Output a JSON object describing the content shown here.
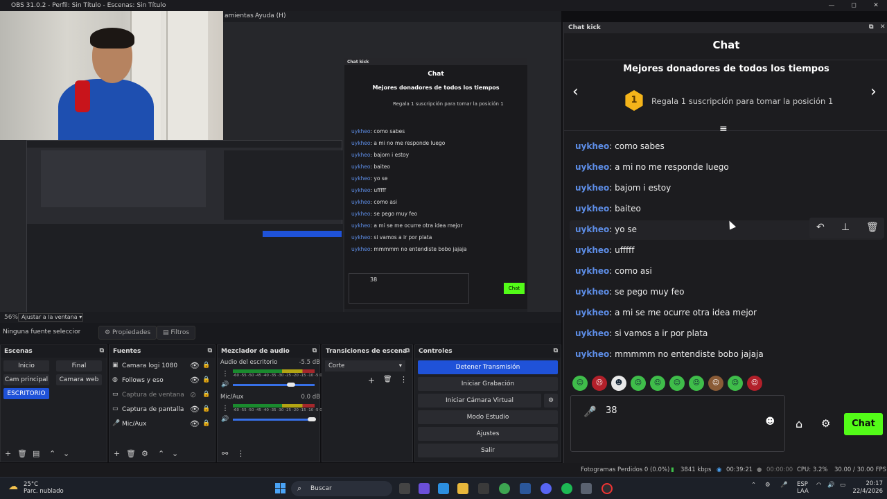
{
  "window": {
    "title": "OBS 31.0.2 - Perfil: Sin Título - Escenas: Sin Título",
    "minimize": "—",
    "maximize": "◻",
    "close": "✕"
  },
  "menu": {
    "item_tools": "amientas",
    "item_help": "Ayuda (H)"
  },
  "preview": {
    "zoom_percent": "56%",
    "zoom_select": "Ajustar a la ventana"
  },
  "properties_bar": {
    "no_source": "Ninguna fuente seleccionada",
    "properties_label": "Propiedades",
    "filters_label": "Filtros"
  },
  "scenes": {
    "title": "Escenas",
    "items": [
      "Inicio",
      "Final",
      "Cam principal",
      "Camara web",
      "ESCRITORIO"
    ],
    "active": "ESCRITORIO"
  },
  "sources": {
    "title": "Fuentes",
    "items": [
      {
        "name": "Camara logi 1080",
        "icon": "camera-icon",
        "visible": true
      },
      {
        "name": "Follows y eso",
        "icon": "globe-icon",
        "visible": true
      },
      {
        "name": "Captura de ventana",
        "icon": "window-icon",
        "visible": false
      },
      {
        "name": "Captura de pantalla",
        "icon": "monitor-icon",
        "visible": true
      },
      {
        "name": "Mic/Aux",
        "icon": "mic-icon",
        "visible": true
      }
    ]
  },
  "mixer": {
    "title": "Mezclador de audio",
    "channels": [
      {
        "name": "Audio del escritorio",
        "db": "-5.5 dB"
      },
      {
        "name": "Mic/Aux",
        "db": "0.0 dB"
      }
    ],
    "ticks": "-60 -55 -50 -45 -40 -35 -30 -25 -20 -15 -10 -5 0"
  },
  "transitions": {
    "title": "Transiciones de escena",
    "selected": "Corte"
  },
  "controls": {
    "title": "Controles",
    "buttons": [
      "Detener Transmisión",
      "Iniciar Grabación",
      "Iniciar Cámara Virtual",
      "Modo Estudio",
      "Ajustes",
      "Salir"
    ]
  },
  "status": {
    "dropped": "Fotogramas Perdidos 0 (0.0%)",
    "kbps": "3841 kbps",
    "stream_time": "00:39:21",
    "rec_time": "00:00:00",
    "cpu": "CPU: 3.2%",
    "fps": "30.00 / 30.00 FPS"
  },
  "chat_dock": {
    "dock_title": "Chat kick",
    "title": "Chat",
    "donors_title": "Mejores donadores de todos los tiempos",
    "medal_rank": "1",
    "gift_text": "Regala 1 suscripción para tomar la posición 1",
    "messages": [
      {
        "user": "uykheo",
        "text": ": como sabes"
      },
      {
        "user": "uykheo",
        "text": ": a mi no me responde luego"
      },
      {
        "user": "uykheo",
        "text": ": bajom i estoy"
      },
      {
        "user": "uykheo",
        "text": ": baiteo"
      },
      {
        "user": "uykheo",
        "text": ": yo se"
      },
      {
        "user": "uykheo",
        "text": ": ufffff"
      },
      {
        "user": "uykheo",
        "text": ": como asi"
      },
      {
        "user": "uykheo",
        "text": ": se pego muy feo"
      },
      {
        "user": "uykheo",
        "text": ": a mi se me ocurre otra idea mejor"
      },
      {
        "user": "uykheo",
        "text": ": si vamos a ir por plata"
      },
      {
        "user": "uykheo",
        "text": ": mmmmm no entendiste bobo jajaja"
      }
    ],
    "input_value": "38",
    "chat_button": "Chat",
    "accent": "#53fc18",
    "username_color": "#5d8de6"
  },
  "inner_chat": {
    "header": "Chat kick",
    "title": "Chat",
    "donors_title": "Mejores donadores de todos los tiempos",
    "gift_text": "Regala 1 suscripción para tomar la posición 1",
    "input_value": "38",
    "chat_button": "Chat"
  },
  "taskbar": {
    "temp": "25°C",
    "weather": "Parc. nublado",
    "search": "Buscar",
    "lang_top": "ESP",
    "lang_bottom": "LAA",
    "time": "20:17",
    "date": "22/4/2026"
  }
}
